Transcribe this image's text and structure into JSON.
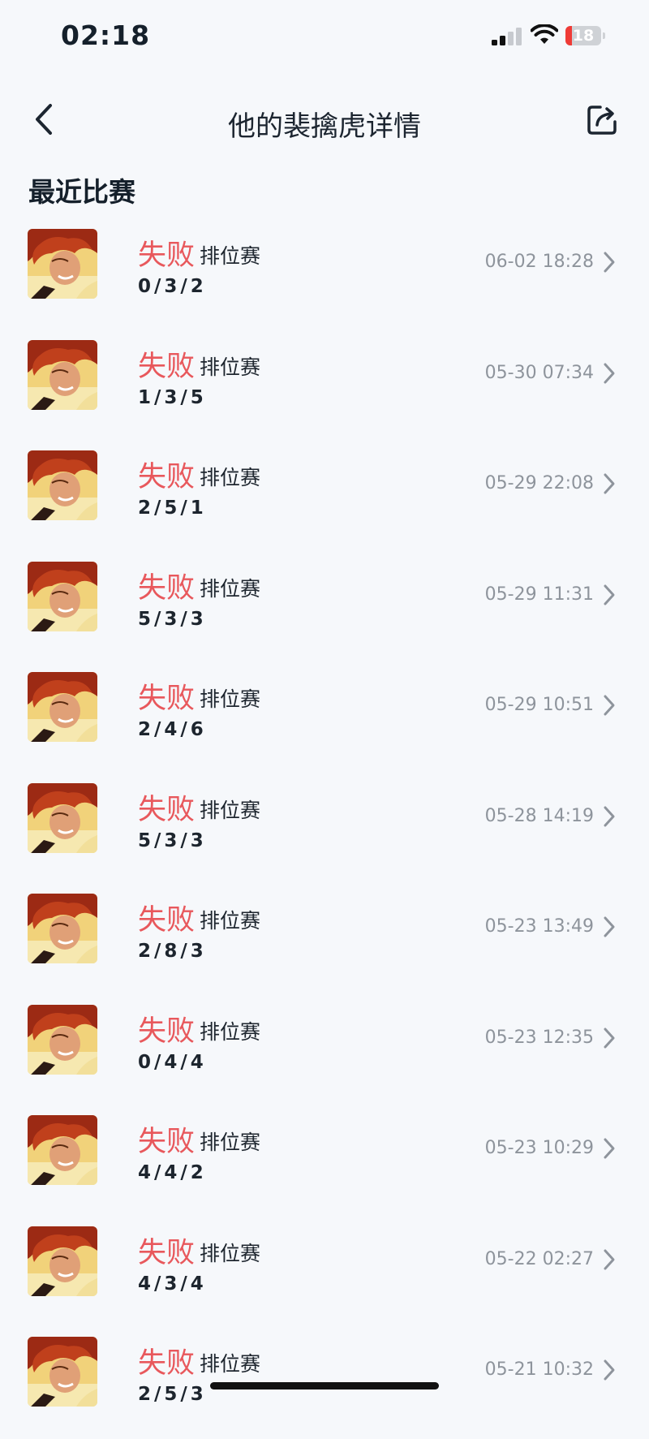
{
  "status_bar": {
    "time": "02:18",
    "battery": "18"
  },
  "nav": {
    "title": "他的裴擒虎详情"
  },
  "section_title": "最近比赛",
  "matches": [
    {
      "result": "失败",
      "mode": "排位赛",
      "kda": "0/3/2",
      "time": "06-02 18:28"
    },
    {
      "result": "失败",
      "mode": "排位赛",
      "kda": "1/3/5",
      "time": "05-30 07:34"
    },
    {
      "result": "失败",
      "mode": "排位赛",
      "kda": "2/5/1",
      "time": "05-29 22:08"
    },
    {
      "result": "失败",
      "mode": "排位赛",
      "kda": "5/3/3",
      "time": "05-29 11:31"
    },
    {
      "result": "失败",
      "mode": "排位赛",
      "kda": "2/4/6",
      "time": "05-29 10:51"
    },
    {
      "result": "失败",
      "mode": "排位赛",
      "kda": "5/3/3",
      "time": "05-28 14:19"
    },
    {
      "result": "失败",
      "mode": "排位赛",
      "kda": "2/8/3",
      "time": "05-23 13:49"
    },
    {
      "result": "失败",
      "mode": "排位赛",
      "kda": "0/4/4",
      "time": "05-23 12:35"
    },
    {
      "result": "失败",
      "mode": "排位赛",
      "kda": "4/4/2",
      "time": "05-23 10:29"
    },
    {
      "result": "失败",
      "mode": "排位赛",
      "kda": "4/3/4",
      "time": "05-22 02:27"
    },
    {
      "result": "失败",
      "mode": "排位赛",
      "kda": "2/5/3",
      "time": "05-21 10:32"
    }
  ],
  "colors": {
    "loss": "#e8585c",
    "accent_text": "#1d252e",
    "muted": "#8e949c",
    "background": "#f6f8fb"
  },
  "icons": {
    "back": "chevron-left-icon",
    "share": "share-icon",
    "row_arrow": "chevron-right-icon",
    "avatar": "hero-portrait"
  }
}
